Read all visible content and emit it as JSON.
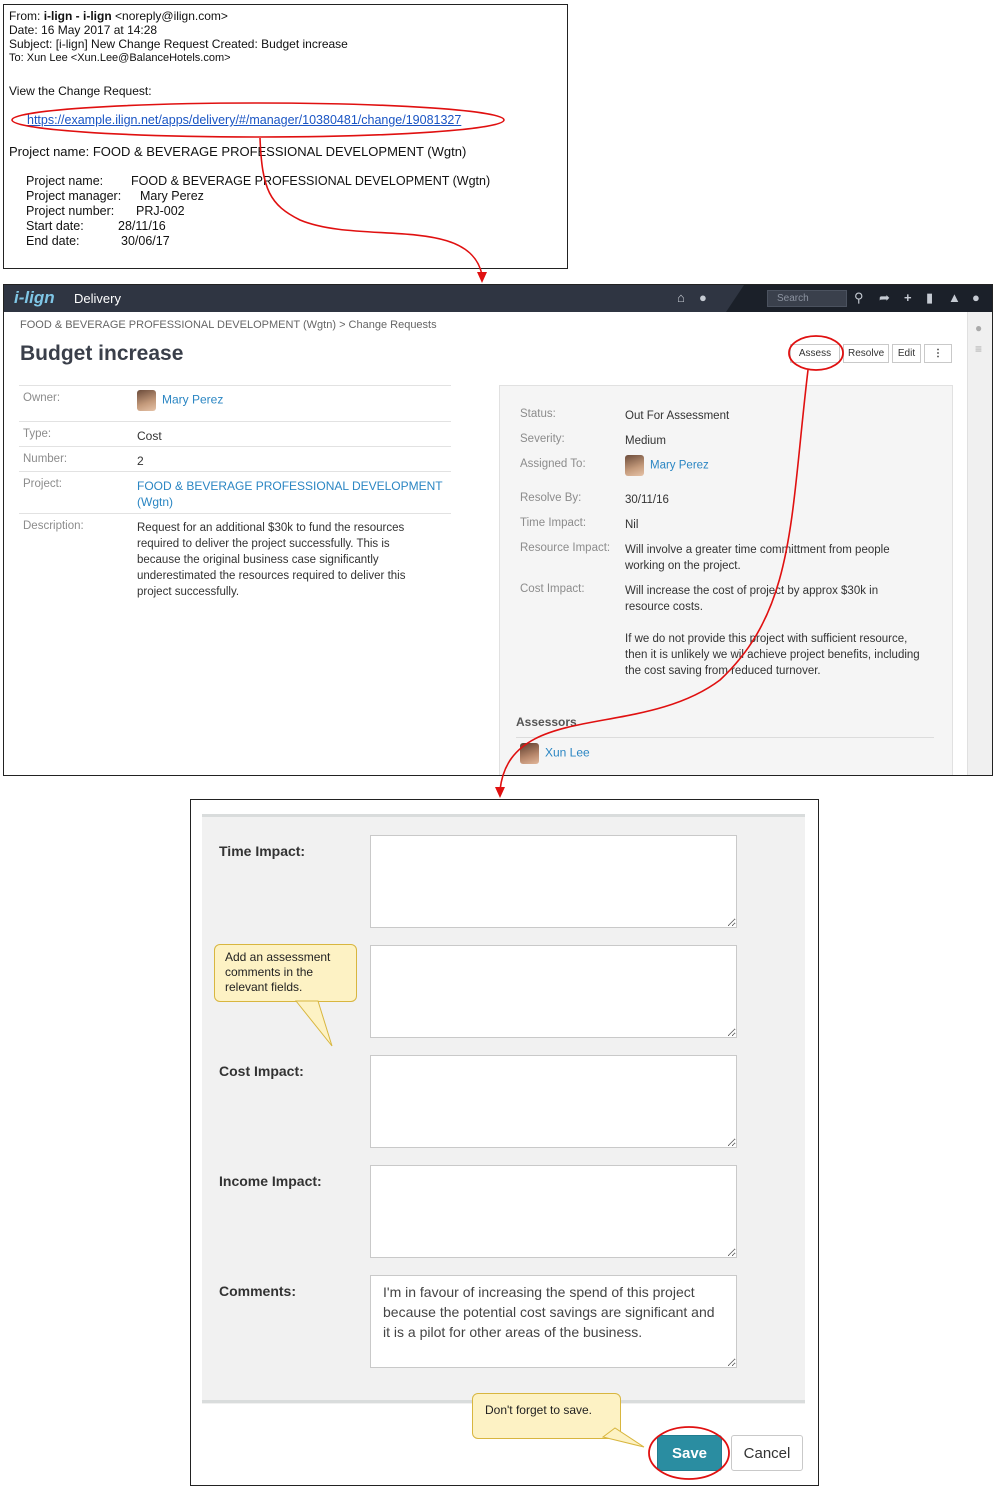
{
  "email": {
    "from_label": "From:",
    "from_name": "i-lign - i-lign",
    "from_addr": "<noreply@ilign.com>",
    "date": "Date: 16 May 2017 at 14:28",
    "subject": "Subject: [i-lign] New Change Request Created: Budget increase",
    "to": "To: Xun Lee <Xun.Lee@BalanceHotels.com>",
    "view_text": "View the Change Request:",
    "link": "https://example.ilign.net/apps/delivery/#/manager/10380481/change/19081327",
    "project_line": "Project name: FOOD & BEVERAGE PROFESSIONAL DEVELOPMENT (Wgtn)",
    "details": [
      {
        "key": "Project name:",
        "value": "FOOD & BEVERAGE PROFESSIONAL DEVELOPMENT (Wgtn)"
      },
      {
        "key": "Project manager:",
        "value": "Mary Perez"
      },
      {
        "key": "Project number:",
        "value": "PRJ-002"
      },
      {
        "key": "Start date:",
        "value": "28/11/16"
      },
      {
        "key": "End date:",
        "value": "30/06/17"
      }
    ]
  },
  "app": {
    "logo": "i-lign",
    "module": "Delivery",
    "search_placeholder": "Search",
    "breadcrumb": "FOOD & BEVERAGE PROFESSIONAL DEVELOPMENT (Wgtn) > Change Requests",
    "title": "Budget increase",
    "actions": {
      "assess": "Assess",
      "resolve": "Resolve",
      "edit": "Edit",
      "more": "⋮"
    },
    "left": [
      {
        "key": "Owner:",
        "value": "Mary Perez"
      },
      {
        "key": "Type:",
        "value": "Cost"
      },
      {
        "key": "Number:",
        "value": "2"
      },
      {
        "key": "Project:",
        "value": "FOOD & BEVERAGE PROFESSIONAL DEVELOPMENT (Wgtn)"
      },
      {
        "key": "Description:",
        "value": "Request for an additional $30k to fund the resources required to deliver the project successfully. This is because the original business case significantly underestimated the resources required to deliver this project successfully."
      }
    ],
    "right": [
      {
        "key": "Status:",
        "value": "Out For Assessment"
      },
      {
        "key": "Severity:",
        "value": "Medium"
      },
      {
        "key": "Assigned To:",
        "value": "Mary Perez"
      },
      {
        "key": "Resolve By:",
        "value": "30/11/16"
      },
      {
        "key": "Time Impact:",
        "value": "Nil"
      },
      {
        "key": "Resource Impact:",
        "value": "Will involve a greater time committment from people working on the project."
      },
      {
        "key": "Cost Impact:",
        "value": "Will increase the cost of project by approx $30k in resource costs."
      },
      {
        "key": "",
        "value": "If we do not provide this project with sufficient resource, then it is unlikely we wil achieve project benefits, including the cost saving from reduced turnover."
      }
    ],
    "assessors_heading": "Assessors",
    "assessor": "Xun Lee"
  },
  "form": {
    "labels": {
      "time": "Time Impact:",
      "cost": "Cost Impact:",
      "income": "Income Impact:",
      "comments": "Comments:"
    },
    "values": {
      "time": "",
      "resource": "",
      "cost": "",
      "income": "",
      "comments": "I'm in favour of increasing the spend of this project because the potential cost savings are significant and it is a pilot for other areas of the business."
    },
    "callout_assess": "Add an assessment comments in the relevant fields.",
    "callout_save": "Don't forget to save.",
    "save": "Save",
    "cancel": "Cancel"
  },
  "colors": {
    "annotation": "#e01010",
    "link": "#2b86c3",
    "save": "#2a8da1",
    "topbar": "#2f3542"
  }
}
